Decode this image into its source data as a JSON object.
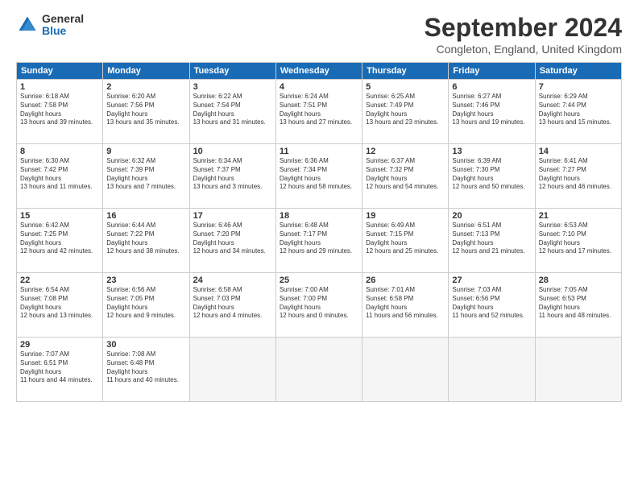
{
  "logo": {
    "general": "General",
    "blue": "Blue"
  },
  "title": "September 2024",
  "subtitle": "Congleton, England, United Kingdom",
  "headers": [
    "Sunday",
    "Monday",
    "Tuesday",
    "Wednesday",
    "Thursday",
    "Friday",
    "Saturday"
  ],
  "days": [
    {
      "num": "",
      "empty": true
    },
    {
      "num": "",
      "empty": true
    },
    {
      "num": "",
      "empty": true
    },
    {
      "num": "",
      "empty": true
    },
    {
      "num": "",
      "empty": true
    },
    {
      "num": "",
      "empty": true
    },
    {
      "num": "1",
      "rise": "6:18 AM",
      "set": "7:58 PM",
      "daylight": "13 hours and 39 minutes."
    },
    {
      "num": "2",
      "rise": "6:20 AM",
      "set": "7:56 PM",
      "daylight": "13 hours and 35 minutes."
    },
    {
      "num": "3",
      "rise": "6:22 AM",
      "set": "7:54 PM",
      "daylight": "13 hours and 31 minutes."
    },
    {
      "num": "4",
      "rise": "6:24 AM",
      "set": "7:51 PM",
      "daylight": "13 hours and 27 minutes."
    },
    {
      "num": "5",
      "rise": "6:25 AM",
      "set": "7:49 PM",
      "daylight": "13 hours and 23 minutes."
    },
    {
      "num": "6",
      "rise": "6:27 AM",
      "set": "7:46 PM",
      "daylight": "13 hours and 19 minutes."
    },
    {
      "num": "7",
      "rise": "6:29 AM",
      "set": "7:44 PM",
      "daylight": "13 hours and 15 minutes."
    },
    {
      "num": "8",
      "rise": "6:30 AM",
      "set": "7:42 PM",
      "daylight": "13 hours and 11 minutes."
    },
    {
      "num": "9",
      "rise": "6:32 AM",
      "set": "7:39 PM",
      "daylight": "13 hours and 7 minutes."
    },
    {
      "num": "10",
      "rise": "6:34 AM",
      "set": "7:37 PM",
      "daylight": "13 hours and 3 minutes."
    },
    {
      "num": "11",
      "rise": "6:36 AM",
      "set": "7:34 PM",
      "daylight": "12 hours and 58 minutes."
    },
    {
      "num": "12",
      "rise": "6:37 AM",
      "set": "7:32 PM",
      "daylight": "12 hours and 54 minutes."
    },
    {
      "num": "13",
      "rise": "6:39 AM",
      "set": "7:30 PM",
      "daylight": "12 hours and 50 minutes."
    },
    {
      "num": "14",
      "rise": "6:41 AM",
      "set": "7:27 PM",
      "daylight": "12 hours and 46 minutes."
    },
    {
      "num": "15",
      "rise": "6:42 AM",
      "set": "7:25 PM",
      "daylight": "12 hours and 42 minutes."
    },
    {
      "num": "16",
      "rise": "6:44 AM",
      "set": "7:22 PM",
      "daylight": "12 hours and 38 minutes."
    },
    {
      "num": "17",
      "rise": "6:46 AM",
      "set": "7:20 PM",
      "daylight": "12 hours and 34 minutes."
    },
    {
      "num": "18",
      "rise": "6:48 AM",
      "set": "7:17 PM",
      "daylight": "12 hours and 29 minutes."
    },
    {
      "num": "19",
      "rise": "6:49 AM",
      "set": "7:15 PM",
      "daylight": "12 hours and 25 minutes."
    },
    {
      "num": "20",
      "rise": "6:51 AM",
      "set": "7:13 PM",
      "daylight": "12 hours and 21 minutes."
    },
    {
      "num": "21",
      "rise": "6:53 AM",
      "set": "7:10 PM",
      "daylight": "12 hours and 17 minutes."
    },
    {
      "num": "22",
      "rise": "6:54 AM",
      "set": "7:08 PM",
      "daylight": "12 hours and 13 minutes."
    },
    {
      "num": "23",
      "rise": "6:56 AM",
      "set": "7:05 PM",
      "daylight": "12 hours and 9 minutes."
    },
    {
      "num": "24",
      "rise": "6:58 AM",
      "set": "7:03 PM",
      "daylight": "12 hours and 4 minutes."
    },
    {
      "num": "25",
      "rise": "7:00 AM",
      "set": "7:00 PM",
      "daylight": "12 hours and 0 minutes."
    },
    {
      "num": "26",
      "rise": "7:01 AM",
      "set": "6:58 PM",
      "daylight": "11 hours and 56 minutes."
    },
    {
      "num": "27",
      "rise": "7:03 AM",
      "set": "6:56 PM",
      "daylight": "11 hours and 52 minutes."
    },
    {
      "num": "28",
      "rise": "7:05 AM",
      "set": "6:53 PM",
      "daylight": "11 hours and 48 minutes."
    },
    {
      "num": "29",
      "rise": "7:07 AM",
      "set": "6:51 PM",
      "daylight": "11 hours and 44 minutes."
    },
    {
      "num": "30",
      "rise": "7:08 AM",
      "set": "6:48 PM",
      "daylight": "11 hours and 40 minutes."
    },
    {
      "num": "",
      "empty": true
    },
    {
      "num": "",
      "empty": true
    },
    {
      "num": "",
      "empty": true
    },
    {
      "num": "",
      "empty": true
    },
    {
      "num": "",
      "empty": true
    }
  ]
}
